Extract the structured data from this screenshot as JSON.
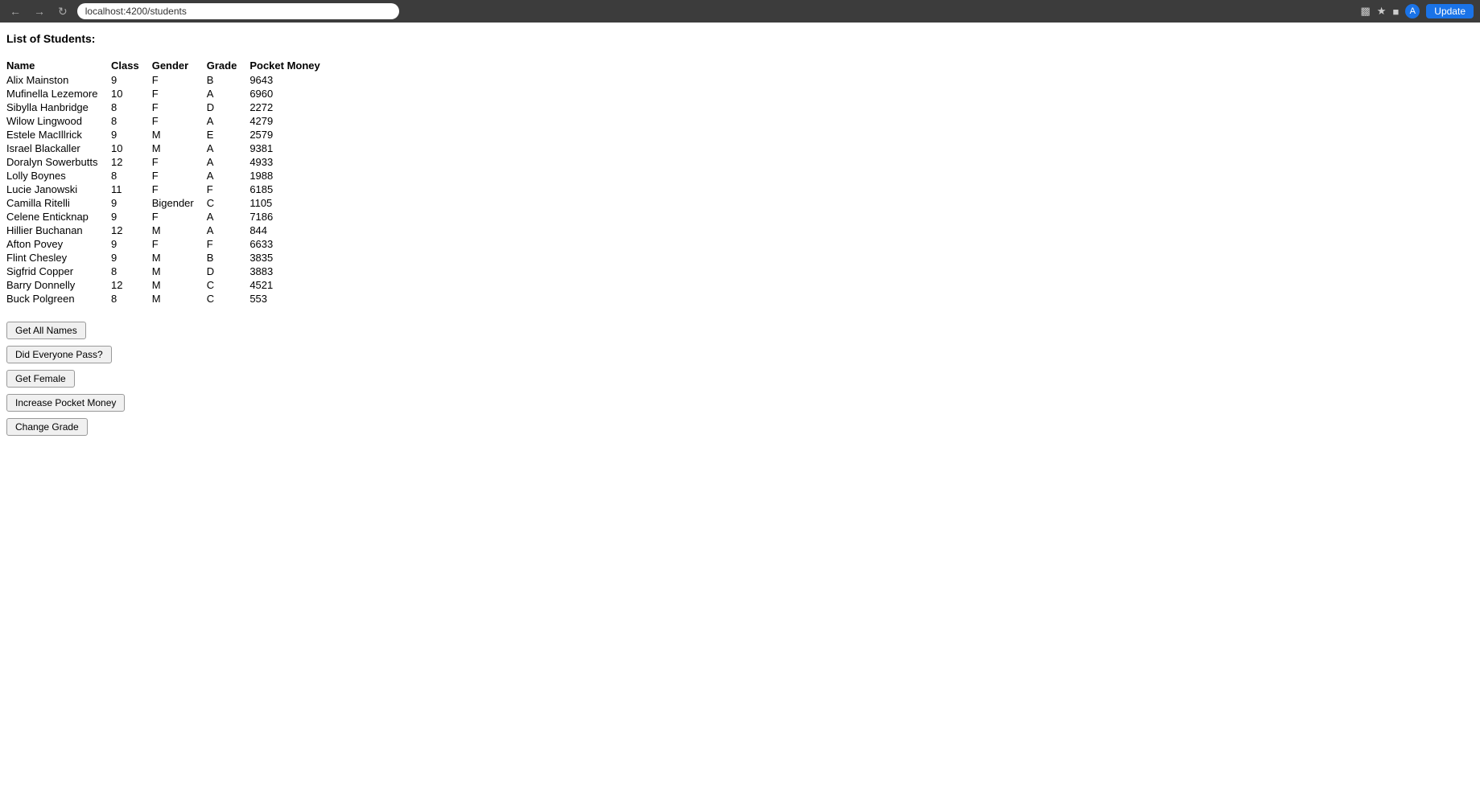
{
  "browser": {
    "url": "localhost:4200/students",
    "update_label": "Update"
  },
  "page": {
    "title": "List of Students:"
  },
  "table": {
    "headers": [
      "Name",
      "Class",
      "Gender",
      "Grade",
      "Pocket Money"
    ],
    "rows": [
      {
        "name": "Alix Mainston",
        "class": "9",
        "gender": "F",
        "grade": "B",
        "pocket_money": "9643"
      },
      {
        "name": "Mufinella Lezemore",
        "class": "10",
        "gender": "F",
        "grade": "A",
        "pocket_money": "6960"
      },
      {
        "name": "Sibylla Hanbridge",
        "class": "8",
        "gender": "F",
        "grade": "D",
        "pocket_money": "2272"
      },
      {
        "name": "Wilow Lingwood",
        "class": "8",
        "gender": "F",
        "grade": "A",
        "pocket_money": "4279"
      },
      {
        "name": "Estele MacIllrick",
        "class": "9",
        "gender": "M",
        "grade": "E",
        "pocket_money": "2579"
      },
      {
        "name": "Israel Blackaller",
        "class": "10",
        "gender": "M",
        "grade": "A",
        "pocket_money": "9381"
      },
      {
        "name": "Doralyn Sowerbutts",
        "class": "12",
        "gender": "F",
        "grade": "A",
        "pocket_money": "4933"
      },
      {
        "name": "Lolly Boynes",
        "class": "8",
        "gender": "F",
        "grade": "A",
        "pocket_money": "1988"
      },
      {
        "name": "Lucie Janowski",
        "class": "11",
        "gender": "F",
        "grade": "F",
        "pocket_money": "6185"
      },
      {
        "name": "Camilla Ritelli",
        "class": "9",
        "gender": "Bigender",
        "grade": "C",
        "pocket_money": "1105"
      },
      {
        "name": "Celene Enticknap",
        "class": "9",
        "gender": "F",
        "grade": "A",
        "pocket_money": "7186"
      },
      {
        "name": "Hillier Buchanan",
        "class": "12",
        "gender": "M",
        "grade": "A",
        "pocket_money": "844"
      },
      {
        "name": "Afton Povey",
        "class": "9",
        "gender": "F",
        "grade": "F",
        "pocket_money": "6633"
      },
      {
        "name": "Flint Chesley",
        "class": "9",
        "gender": "M",
        "grade": "B",
        "pocket_money": "3835"
      },
      {
        "name": "Sigfrid Copper",
        "class": "8",
        "gender": "M",
        "grade": "D",
        "pocket_money": "3883"
      },
      {
        "name": "Barry Donnelly",
        "class": "12",
        "gender": "M",
        "grade": "C",
        "pocket_money": "4521"
      },
      {
        "name": "Buck Polgreen",
        "class": "8",
        "gender": "M",
        "grade": "C",
        "pocket_money": "553"
      }
    ]
  },
  "buttons": {
    "get_all_names": "Get All Names",
    "did_everyone_pass": "Did Everyone Pass?",
    "get_female": "Get Female",
    "increase_pocket_money": "Increase Pocket Money",
    "change_grade": "Change Grade"
  }
}
